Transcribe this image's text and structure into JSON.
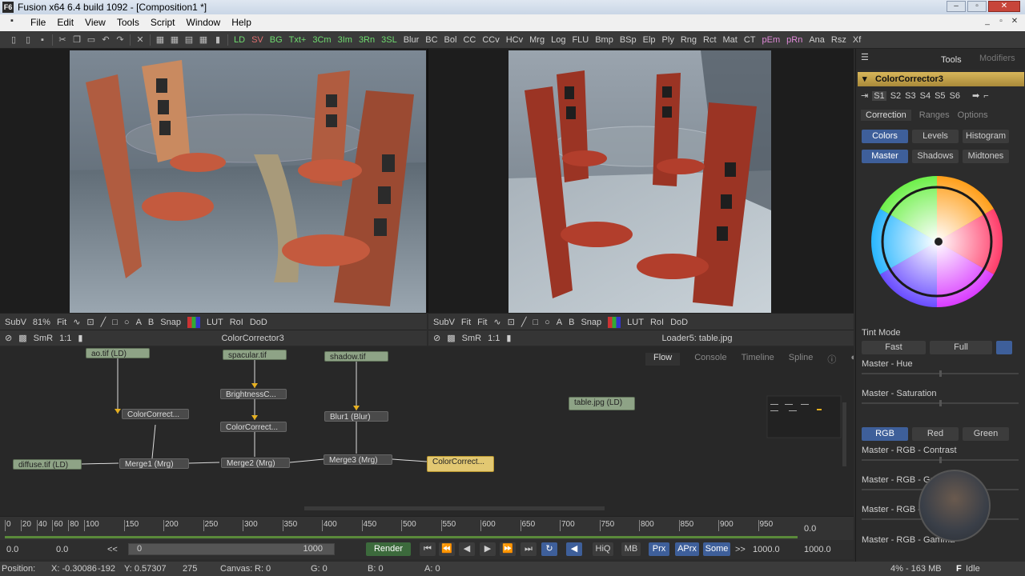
{
  "window": {
    "title": "Fusion x64 6.4 build 1092 - [Composition1 *]",
    "app_icon": "F6"
  },
  "menu": [
    "File",
    "Edit",
    "View",
    "Tools",
    "Script",
    "Window",
    "Help"
  ],
  "toolbar_tools": [
    {
      "label": "LD",
      "c": "g"
    },
    {
      "label": "SV",
      "c": "r"
    },
    {
      "label": "BG",
      "c": "g"
    },
    {
      "label": "Txt+",
      "c": "g"
    },
    {
      "label": "3Cm",
      "c": "g"
    },
    {
      "label": "3Im",
      "c": "g"
    },
    {
      "label": "3Rn",
      "c": "g"
    },
    {
      "label": "3SL",
      "c": "g"
    },
    {
      "label": "Blur",
      "c": ""
    },
    {
      "label": "BC",
      "c": ""
    },
    {
      "label": "Bol",
      "c": ""
    },
    {
      "label": "CC",
      "c": ""
    },
    {
      "label": "CCv",
      "c": ""
    },
    {
      "label": "HCv",
      "c": ""
    },
    {
      "label": "Mrg",
      "c": ""
    },
    {
      "label": "Log",
      "c": ""
    },
    {
      "label": "FLU",
      "c": ""
    },
    {
      "label": "Bmp",
      "c": ""
    },
    {
      "label": "BSp",
      "c": ""
    },
    {
      "label": "Elp",
      "c": ""
    },
    {
      "label": "Ply",
      "c": ""
    },
    {
      "label": "Rng",
      "c": ""
    },
    {
      "label": "Rct",
      "c": ""
    },
    {
      "label": "Mat",
      "c": ""
    },
    {
      "label": "CT",
      "c": ""
    },
    {
      "label": "pEm",
      "c": "p"
    },
    {
      "label": "pRn",
      "c": "p"
    },
    {
      "label": "Ana",
      "c": ""
    },
    {
      "label": "Rsz",
      "c": ""
    },
    {
      "label": "Xf",
      "c": ""
    }
  ],
  "viewer_left": {
    "subv": "SubV",
    "zoom": "81%",
    "fit": "Fit",
    "snap": "Snap",
    "lut": "LUT",
    "roi": "RoI",
    "dod": "DoD",
    "smr": "SmR",
    "ratio": "1:1",
    "label": "ColorCorrector3"
  },
  "viewer_right": {
    "subv": "SubV",
    "fit": "Fit",
    "fit2": "Fit",
    "snap": "Snap",
    "lut": "LUT",
    "roi": "RoI",
    "dod": "DoD",
    "smr": "SmR",
    "ratio": "1:1",
    "label": "Loader5: table.jpg"
  },
  "flow_tabs": {
    "flow": "Flow",
    "console": "Console",
    "timeline": "Timeline",
    "spline": "Spline"
  },
  "nodes": {
    "ao": "ao.tif  (LD)",
    "spacular": "spacular.tif",
    "shadow": "shadow.tif",
    "brightness": "BrightnessC...",
    "cc1": "ColorCorrect...",
    "cc2": "ColorCorrect...",
    "blur": "Blur1 (Blur)",
    "diffuse": "diffuse.tif (LD)",
    "merge1": "Merge1 (Mrg)",
    "merge2": "Merge2 (Mrg)",
    "merge3": "Merge3 (Mrg)",
    "cc3": "ColorCorrect...",
    "table": "table.jpg  (LD)"
  },
  "ruler_ticks": [
    "0",
    "20",
    "40",
    "60",
    "80",
    "100",
    "150",
    "200",
    "250",
    "300",
    "350",
    "400",
    "450",
    "500",
    "550",
    "600",
    "650",
    "700",
    "750",
    "800",
    "850",
    "900",
    "950"
  ],
  "timeline": {
    "current": "0.0",
    "start": "0.0",
    "start2": "0.0",
    "range_start": "0",
    "range_end": "1000",
    "render": "Render",
    "hiq": "HiQ",
    "mb": "MB",
    "prx": "Prx",
    "aprx": "APrx",
    "some": "Some",
    "end": "1000.0",
    "end2": "1000.0",
    "rewind": "<<",
    "fwd": ">>"
  },
  "status": {
    "position": "Position:",
    "x": "X: -0.30086",
    "xv": "-192",
    "y": "Y: 0.57307",
    "yv": "275",
    "canvas": "Canvas:",
    "r": "R: 0",
    "g": "G: 0",
    "b": "B: 0",
    "a": "A: 0",
    "mem": "4% - 163 MB",
    "state": "Idle",
    "state_icon": "F"
  },
  "panel": {
    "tabs": {
      "tools": "Tools",
      "modifiers": "Modifiers"
    },
    "tool_name": "ColorCorrector3",
    "slots": [
      "S1",
      "S2",
      "S3",
      "S4",
      "S5",
      "S6"
    ],
    "subtabs": {
      "correction": "Correction",
      "ranges": "Ranges",
      "options": "Options"
    },
    "btn1": {
      "colors": "Colors",
      "levels": "Levels",
      "histogram": "Histogram"
    },
    "btn2": {
      "master": "Master",
      "shadows": "Shadows",
      "midtones": "Midtones"
    },
    "tint_mode": "Tint Mode",
    "tint": {
      "fast": "Fast",
      "full": "Full"
    },
    "master_hue": "Master - Hue",
    "master_sat": "Master - Saturation",
    "rgb": {
      "rgb": "RGB",
      "red": "Red",
      "green": "Green"
    },
    "rgb_contrast": "Master - RGB - Contrast",
    "rgb_gain": "Master - RGB - Gain",
    "rgb_lift": "Master - RGB - Lift",
    "rgb_gamma": "Master - RGB - Gamma"
  }
}
